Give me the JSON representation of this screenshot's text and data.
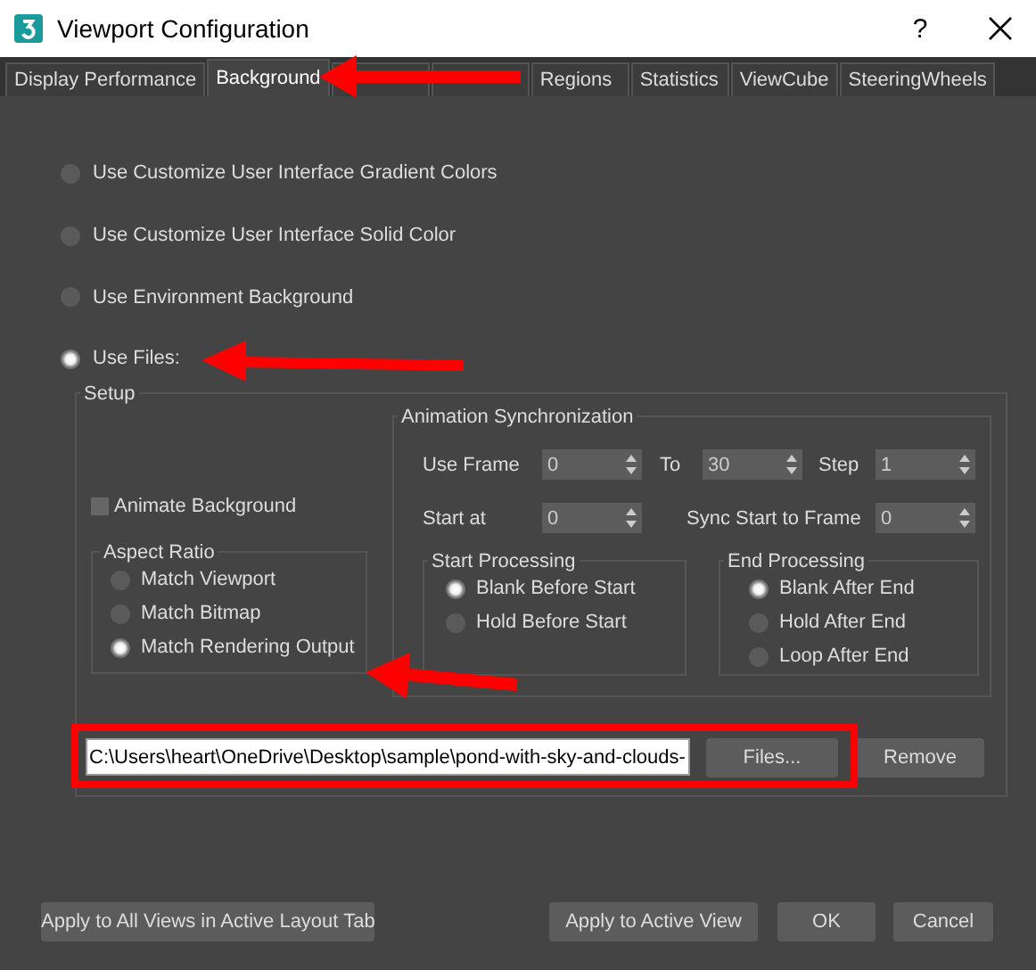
{
  "window": {
    "title": "Viewport Configuration",
    "help": "?"
  },
  "tabs": [
    {
      "label": "Display Performance",
      "selected": false
    },
    {
      "label": "Background",
      "selected": true
    },
    {
      "selected": false
    },
    {
      "selected": false
    },
    {
      "label": "Regions",
      "selected": false
    },
    {
      "label": "Statistics",
      "selected": false
    },
    {
      "label": "ViewCube",
      "selected": false
    },
    {
      "label": "SteeringWheels",
      "selected": false
    }
  ],
  "background_options": [
    {
      "label": "Use Customize User Interface Gradient Colors",
      "selected": false
    },
    {
      "label": "Use Customize User Interface Solid Color",
      "selected": false
    },
    {
      "label": "Use Environment Background",
      "selected": false
    },
    {
      "label": "Use Files:",
      "selected": true
    }
  ],
  "setup": {
    "title": "Setup",
    "animate_background": {
      "label": "Animate Background",
      "checked": false
    },
    "aspect_ratio": {
      "title": "Aspect Ratio",
      "options": [
        {
          "label": "Match Viewport",
          "selected": false
        },
        {
          "label": "Match Bitmap",
          "selected": false
        },
        {
          "label": "Match Rendering Output",
          "selected": true
        }
      ]
    },
    "animation_sync": {
      "title": "Animation Synchronization",
      "fields": [
        {
          "label": "Use Frame",
          "value": "0"
        },
        {
          "label": "To",
          "value": "30"
        },
        {
          "label": "Step",
          "value": "1"
        },
        {
          "label": "Start at",
          "value": "0"
        },
        {
          "label": "Sync Start to Frame",
          "value": "0"
        }
      ],
      "start_processing": {
        "title": "Start Processing",
        "options": [
          {
            "label": "Blank Before Start",
            "selected": true
          },
          {
            "label": "Hold Before Start",
            "selected": false
          }
        ]
      },
      "end_processing": {
        "title": "End Processing",
        "options": [
          {
            "label": "Blank After End",
            "selected": true
          },
          {
            "label": "Hold After End",
            "selected": false
          },
          {
            "label": "Loop After End",
            "selected": false
          }
        ]
      }
    },
    "file": {
      "path": "C:\\Users\\heart\\OneDrive\\Desktop\\sample\\pond-with-sky-and-clouds-",
      "browse": "Files...",
      "remove": "Remove"
    }
  },
  "buttons": [
    {
      "label": "Apply to All Views in Active Layout Tab"
    },
    {
      "label": "Apply to Active View"
    },
    {
      "label": "OK"
    },
    {
      "label": "Cancel"
    }
  ]
}
